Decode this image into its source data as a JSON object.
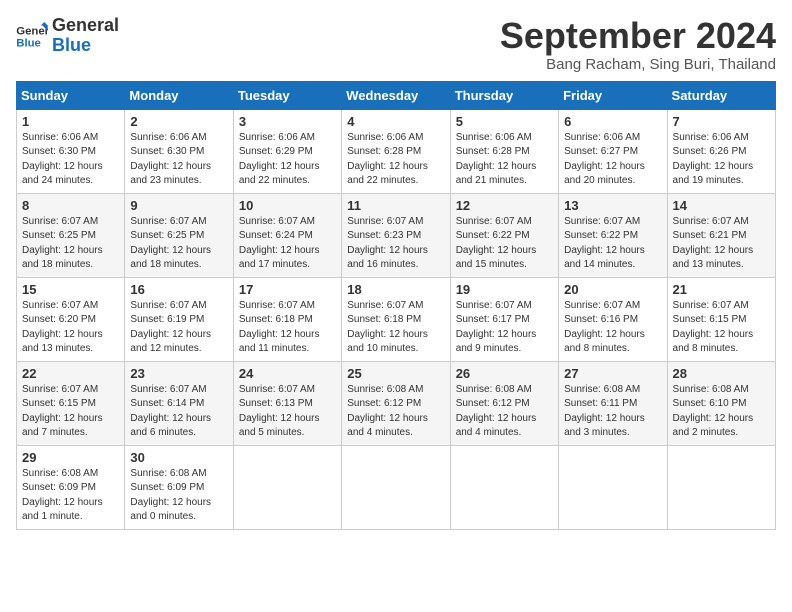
{
  "header": {
    "logo_line1": "General",
    "logo_line2": "Blue",
    "title": "September 2024",
    "subtitle": "Bang Racham, Sing Buri, Thailand"
  },
  "days_of_week": [
    "Sunday",
    "Monday",
    "Tuesday",
    "Wednesday",
    "Thursday",
    "Friday",
    "Saturday"
  ],
  "weeks": [
    [
      {
        "day": "1",
        "sunrise": "Sunrise: 6:06 AM",
        "sunset": "Sunset: 6:30 PM",
        "daylight": "Daylight: 12 hours and 24 minutes."
      },
      {
        "day": "2",
        "sunrise": "Sunrise: 6:06 AM",
        "sunset": "Sunset: 6:30 PM",
        "daylight": "Daylight: 12 hours and 23 minutes."
      },
      {
        "day": "3",
        "sunrise": "Sunrise: 6:06 AM",
        "sunset": "Sunset: 6:29 PM",
        "daylight": "Daylight: 12 hours and 22 minutes."
      },
      {
        "day": "4",
        "sunrise": "Sunrise: 6:06 AM",
        "sunset": "Sunset: 6:28 PM",
        "daylight": "Daylight: 12 hours and 22 minutes."
      },
      {
        "day": "5",
        "sunrise": "Sunrise: 6:06 AM",
        "sunset": "Sunset: 6:28 PM",
        "daylight": "Daylight: 12 hours and 21 minutes."
      },
      {
        "day": "6",
        "sunrise": "Sunrise: 6:06 AM",
        "sunset": "Sunset: 6:27 PM",
        "daylight": "Daylight: 12 hours and 20 minutes."
      },
      {
        "day": "7",
        "sunrise": "Sunrise: 6:06 AM",
        "sunset": "Sunset: 6:26 PM",
        "daylight": "Daylight: 12 hours and 19 minutes."
      }
    ],
    [
      {
        "day": "8",
        "sunrise": "Sunrise: 6:07 AM",
        "sunset": "Sunset: 6:25 PM",
        "daylight": "Daylight: 12 hours and 18 minutes."
      },
      {
        "day": "9",
        "sunrise": "Sunrise: 6:07 AM",
        "sunset": "Sunset: 6:25 PM",
        "daylight": "Daylight: 12 hours and 18 minutes."
      },
      {
        "day": "10",
        "sunrise": "Sunrise: 6:07 AM",
        "sunset": "Sunset: 6:24 PM",
        "daylight": "Daylight: 12 hours and 17 minutes."
      },
      {
        "day": "11",
        "sunrise": "Sunrise: 6:07 AM",
        "sunset": "Sunset: 6:23 PM",
        "daylight": "Daylight: 12 hours and 16 minutes."
      },
      {
        "day": "12",
        "sunrise": "Sunrise: 6:07 AM",
        "sunset": "Sunset: 6:22 PM",
        "daylight": "Daylight: 12 hours and 15 minutes."
      },
      {
        "day": "13",
        "sunrise": "Sunrise: 6:07 AM",
        "sunset": "Sunset: 6:22 PM",
        "daylight": "Daylight: 12 hours and 14 minutes."
      },
      {
        "day": "14",
        "sunrise": "Sunrise: 6:07 AM",
        "sunset": "Sunset: 6:21 PM",
        "daylight": "Daylight: 12 hours and 13 minutes."
      }
    ],
    [
      {
        "day": "15",
        "sunrise": "Sunrise: 6:07 AM",
        "sunset": "Sunset: 6:20 PM",
        "daylight": "Daylight: 12 hours and 13 minutes."
      },
      {
        "day": "16",
        "sunrise": "Sunrise: 6:07 AM",
        "sunset": "Sunset: 6:19 PM",
        "daylight": "Daylight: 12 hours and 12 minutes."
      },
      {
        "day": "17",
        "sunrise": "Sunrise: 6:07 AM",
        "sunset": "Sunset: 6:18 PM",
        "daylight": "Daylight: 12 hours and 11 minutes."
      },
      {
        "day": "18",
        "sunrise": "Sunrise: 6:07 AM",
        "sunset": "Sunset: 6:18 PM",
        "daylight": "Daylight: 12 hours and 10 minutes."
      },
      {
        "day": "19",
        "sunrise": "Sunrise: 6:07 AM",
        "sunset": "Sunset: 6:17 PM",
        "daylight": "Daylight: 12 hours and 9 minutes."
      },
      {
        "day": "20",
        "sunrise": "Sunrise: 6:07 AM",
        "sunset": "Sunset: 6:16 PM",
        "daylight": "Daylight: 12 hours and 8 minutes."
      },
      {
        "day": "21",
        "sunrise": "Sunrise: 6:07 AM",
        "sunset": "Sunset: 6:15 PM",
        "daylight": "Daylight: 12 hours and 8 minutes."
      }
    ],
    [
      {
        "day": "22",
        "sunrise": "Sunrise: 6:07 AM",
        "sunset": "Sunset: 6:15 PM",
        "daylight": "Daylight: 12 hours and 7 minutes."
      },
      {
        "day": "23",
        "sunrise": "Sunrise: 6:07 AM",
        "sunset": "Sunset: 6:14 PM",
        "daylight": "Daylight: 12 hours and 6 minutes."
      },
      {
        "day": "24",
        "sunrise": "Sunrise: 6:07 AM",
        "sunset": "Sunset: 6:13 PM",
        "daylight": "Daylight: 12 hours and 5 minutes."
      },
      {
        "day": "25",
        "sunrise": "Sunrise: 6:08 AM",
        "sunset": "Sunset: 6:12 PM",
        "daylight": "Daylight: 12 hours and 4 minutes."
      },
      {
        "day": "26",
        "sunrise": "Sunrise: 6:08 AM",
        "sunset": "Sunset: 6:12 PM",
        "daylight": "Daylight: 12 hours and 4 minutes."
      },
      {
        "day": "27",
        "sunrise": "Sunrise: 6:08 AM",
        "sunset": "Sunset: 6:11 PM",
        "daylight": "Daylight: 12 hours and 3 minutes."
      },
      {
        "day": "28",
        "sunrise": "Sunrise: 6:08 AM",
        "sunset": "Sunset: 6:10 PM",
        "daylight": "Daylight: 12 hours and 2 minutes."
      }
    ],
    [
      {
        "day": "29",
        "sunrise": "Sunrise: 6:08 AM",
        "sunset": "Sunset: 6:09 PM",
        "daylight": "Daylight: 12 hours and 1 minute."
      },
      {
        "day": "30",
        "sunrise": "Sunrise: 6:08 AM",
        "sunset": "Sunset: 6:09 PM",
        "daylight": "Daylight: 12 hours and 0 minutes."
      },
      null,
      null,
      null,
      null,
      null
    ]
  ]
}
